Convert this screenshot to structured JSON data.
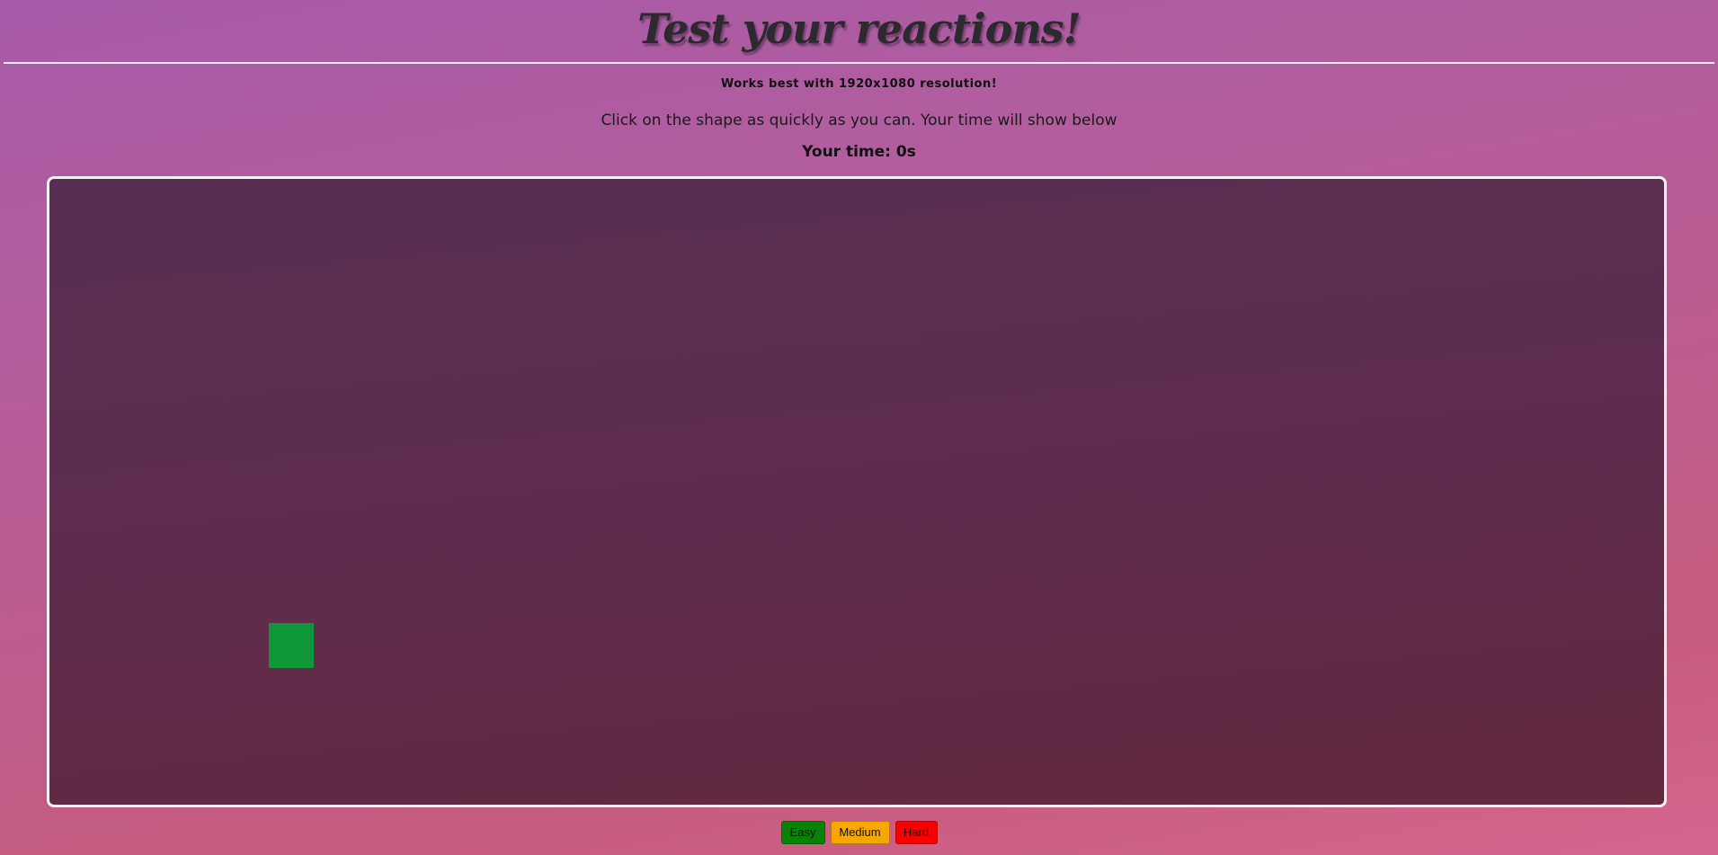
{
  "header": {
    "title": "Test your reactions!"
  },
  "note": "Works best with 1920x1080 resolution!",
  "instructions": "Click on the shape as quickly as you can. Your time will show below",
  "time": "Your time: 0s",
  "game": {
    "shape_color": "#10973a",
    "shape_type": "square"
  },
  "difficulty": {
    "easy_label": "Easy",
    "medium_label": "Medium",
    "hard_label": "Hard",
    "easy_color": "#078307",
    "medium_color": "#f6a700",
    "hard_color": "#fa0000"
  }
}
